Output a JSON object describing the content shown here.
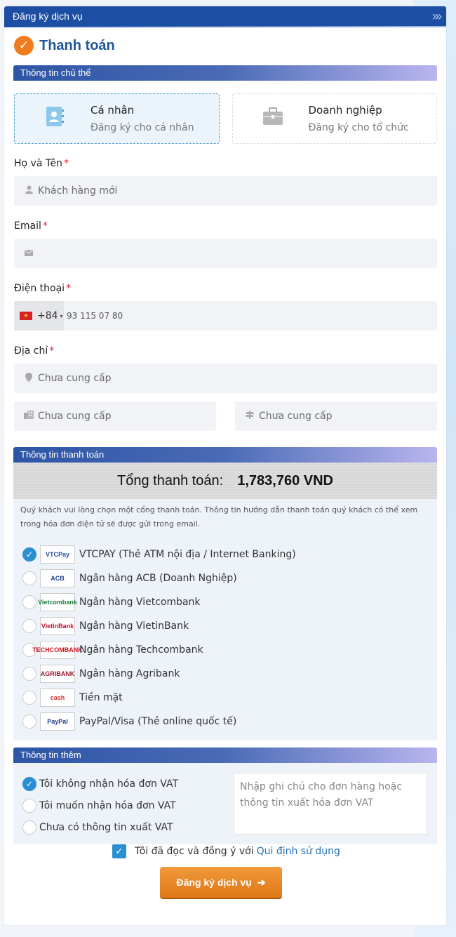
{
  "header": {
    "title": "Đăng ký dịch vụ"
  },
  "page": {
    "title": "Thanh toán"
  },
  "subject": {
    "section_title": "Thông tin chủ thể",
    "types": [
      {
        "label": "Cá nhân",
        "desc": "Đăng ký cho cá nhân",
        "icon": "contact-book-icon",
        "selected": true
      },
      {
        "label": "Doanh nghiệp",
        "desc": "Đăng ký cho tổ chức",
        "icon": "briefcase-icon",
        "selected": false
      }
    ]
  },
  "form": {
    "name_label": "Họ và Tên",
    "name_value": "Khách hàng mới",
    "email_label": "Email",
    "email_value": "",
    "phone_label": "Điện thoại",
    "phone_code": "+84",
    "phone_value": "93 115 07 80",
    "address_label": "Địa chỉ",
    "address_placeholder": "Chưa cung cấp",
    "city_placeholder": "Chưa cung cấp",
    "district_placeholder": "Chưa cung cấp",
    "required_mark": "*"
  },
  "payment": {
    "section_title": "Thông tin thanh toán",
    "total_label": "Tổng thanh toán:",
    "total_value": "1,783,760 VND",
    "note": "Quý khách vui lòng chọn một cổng thanh toán. Thông tin hướng dẫn thanh toán quý khách có thể xem trong hóa đơn điện tử sẽ được gửi trong email.",
    "methods": [
      {
        "name": "VTCPAY (Thẻ ATM nội địa / Internet Banking)",
        "logo": "VTCPay",
        "color": "#1f4e9c",
        "selected": true
      },
      {
        "name": "Ngân hàng ACB (Doanh Nghiệp)",
        "logo": "ACB",
        "color": "#1f3f8f",
        "selected": false
      },
      {
        "name": "Ngân hàng Vietcombank",
        "logo": "Vietcombank",
        "color": "#1f7a3a",
        "selected": false
      },
      {
        "name": "Ngân hàng VietinBank",
        "logo": "VietinBank",
        "color": "#c8102e",
        "selected": false
      },
      {
        "name": "Ngân hàng Techcombank",
        "logo": "TECHCOMBANK",
        "color": "#d5141c",
        "selected": false
      },
      {
        "name": "Ngân hàng Agribank",
        "logo": "AGRIBANK",
        "color": "#9b1b30",
        "selected": false
      },
      {
        "name": "Tiền mặt",
        "logo": "cash",
        "color": "#d12f2f",
        "selected": false
      },
      {
        "name": "PayPal/Visa (Thẻ online quốc tế)",
        "logo": "PayPal",
        "color": "#1e3a8a",
        "selected": false
      }
    ]
  },
  "extra": {
    "section_title": "Thông tin thêm",
    "vat_options": [
      {
        "label": "Tôi không nhận hóa đơn VAT",
        "selected": true
      },
      {
        "label": "Tôi muốn nhận hóa đơn VAT",
        "selected": false
      },
      {
        "label": "Chưa có thông tin xuất VAT",
        "selected": false
      }
    ],
    "note_placeholder": "Nhập ghi chú cho đơn hàng hoặc thông tin xuất hóa đơn VAT"
  },
  "agreement": {
    "text": "Tôi đã đọc và đồng ý với",
    "link": "Qui định sử dụng"
  },
  "submit": {
    "label": "Đăng ký dịch vụ"
  },
  "colors": {
    "brand": "#1c4fa3",
    "accent": "#f07c1e",
    "check": "#2a8fd0"
  }
}
